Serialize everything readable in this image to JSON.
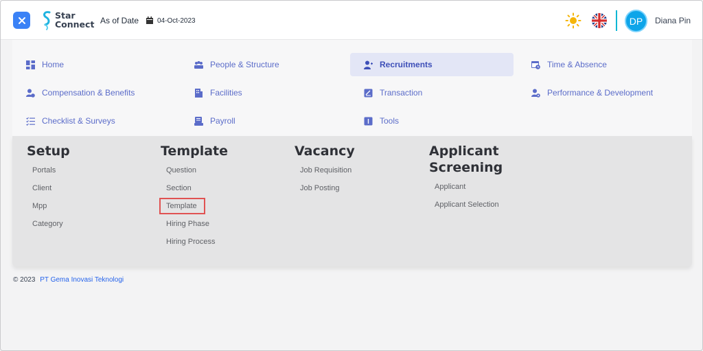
{
  "header": {
    "logo_line1": "Star",
    "logo_line2": "Connect",
    "as_of_label": "As of Date",
    "date": "04-Oct-2023",
    "avatar_initials": "DP",
    "user_name": "Diana Pin",
    "accent_color": "#3b82f6"
  },
  "menu": {
    "items": [
      {
        "label": "Home",
        "icon": "dashboard-icon"
      },
      {
        "label": "People & Structure",
        "icon": "people-icon"
      },
      {
        "label": "Recruitments",
        "icon": "user-plus-icon",
        "active": true
      },
      {
        "label": "Time & Absence",
        "icon": "calendar-clock-icon"
      },
      {
        "label": "Compensation & Benefits",
        "icon": "user-money-icon"
      },
      {
        "label": "Facilities",
        "icon": "building-icon"
      },
      {
        "label": "Transaction",
        "icon": "transaction-icon"
      },
      {
        "label": "Performance & Development",
        "icon": "user-gear-icon"
      },
      {
        "label": "Checklist & Surveys",
        "icon": "checklist-icon"
      },
      {
        "label": "Payroll",
        "icon": "payroll-icon"
      },
      {
        "label": "Tools",
        "icon": "tools-icon"
      }
    ]
  },
  "submenu": {
    "setup": {
      "title": "Setup",
      "items": [
        "Portals",
        "Client",
        "Mpp",
        "Category"
      ]
    },
    "template": {
      "title": "Template",
      "items": [
        "Question",
        "Section",
        "Template",
        "Hiring Phase",
        "Hiring Process"
      ],
      "highlighted": "Template"
    },
    "vacancy": {
      "title": "Vacancy",
      "items": [
        "Job Requisition",
        "Job Posting"
      ]
    },
    "applicant": {
      "title_line1": "Applicant",
      "title_line2": "Screening",
      "items": [
        "Applicant",
        "Applicant Selection"
      ]
    }
  },
  "footer": {
    "copyright": "© 2023",
    "company": "PT Gema Inovasi Teknologi"
  }
}
